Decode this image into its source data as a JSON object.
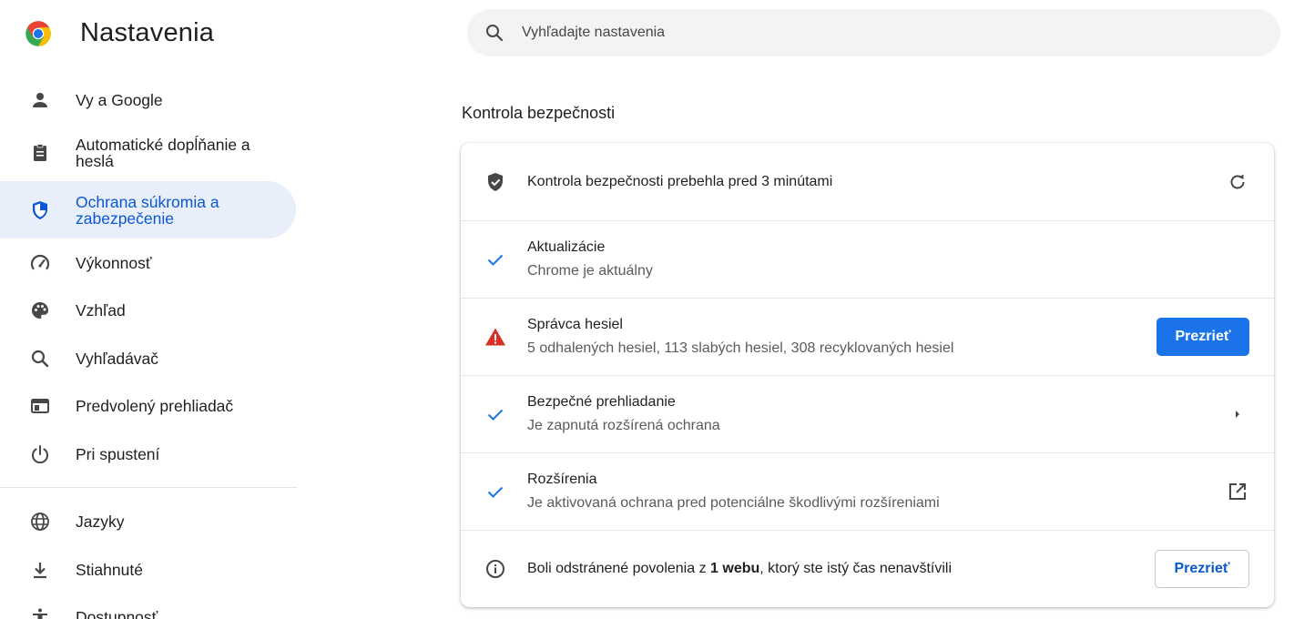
{
  "header": {
    "title": "Nastavenia",
    "search_placeholder": "Vyhľadajte nastavenia"
  },
  "sidebar": {
    "items": [
      {
        "label": "Vy a Google",
        "icon": "person-icon"
      },
      {
        "label": "Automatické dopĺňanie a heslá",
        "icon": "clipboard-icon"
      },
      {
        "label": "Ochrana súkromia a zabezpečenie",
        "icon": "shield-icon",
        "active": true
      },
      {
        "label": "Výkonnosť",
        "icon": "speedometer-icon"
      },
      {
        "label": "Vzhľad",
        "icon": "palette-icon"
      },
      {
        "label": "Vyhľadávač",
        "icon": "search-icon"
      },
      {
        "label": "Predvolený prehliadač",
        "icon": "browser-window-icon"
      },
      {
        "label": "Pri spustení",
        "icon": "power-icon"
      },
      {
        "label": "Jazyky",
        "icon": "globe-icon"
      },
      {
        "label": "Stiahnuté",
        "icon": "download-icon"
      },
      {
        "label": "Dostupnosť",
        "icon": "accessibility-icon"
      }
    ]
  },
  "main": {
    "section_title": "Kontrola bezpečnosti",
    "rows": {
      "summary": {
        "title": "Kontrola bezpečnosti prebehla pred 3 minútami"
      },
      "updates": {
        "title": "Aktualizácie",
        "subtitle": "Chrome je aktuálny"
      },
      "passwords": {
        "title": "Správca hesiel",
        "subtitle": "5 odhalených hesiel, 113 slabých hesiel, 308 recyklovaných hesiel",
        "button": "Prezrieť"
      },
      "safe_browsing": {
        "title": "Bezpečné prehliadanie",
        "subtitle": "Je zapnutá rozšírená ochrana"
      },
      "extensions": {
        "title": "Rozšírenia",
        "subtitle": "Je aktivovaná ochrana pred potenciálne škodlivými rozšíreniami"
      },
      "permissions": {
        "title_pre": "Boli odstránené povolenia z ",
        "title_bold": "1 webu",
        "title_post": ", ktorý ste istý čas nenavštívili",
        "button": "Prezrieť"
      }
    }
  },
  "colors": {
    "accent": "#1a73e8",
    "active_bg": "#e8effb",
    "active_text": "#0b57d0",
    "check": "#1a73e8",
    "warning": "#d93025",
    "icon_gray": "#474747"
  }
}
